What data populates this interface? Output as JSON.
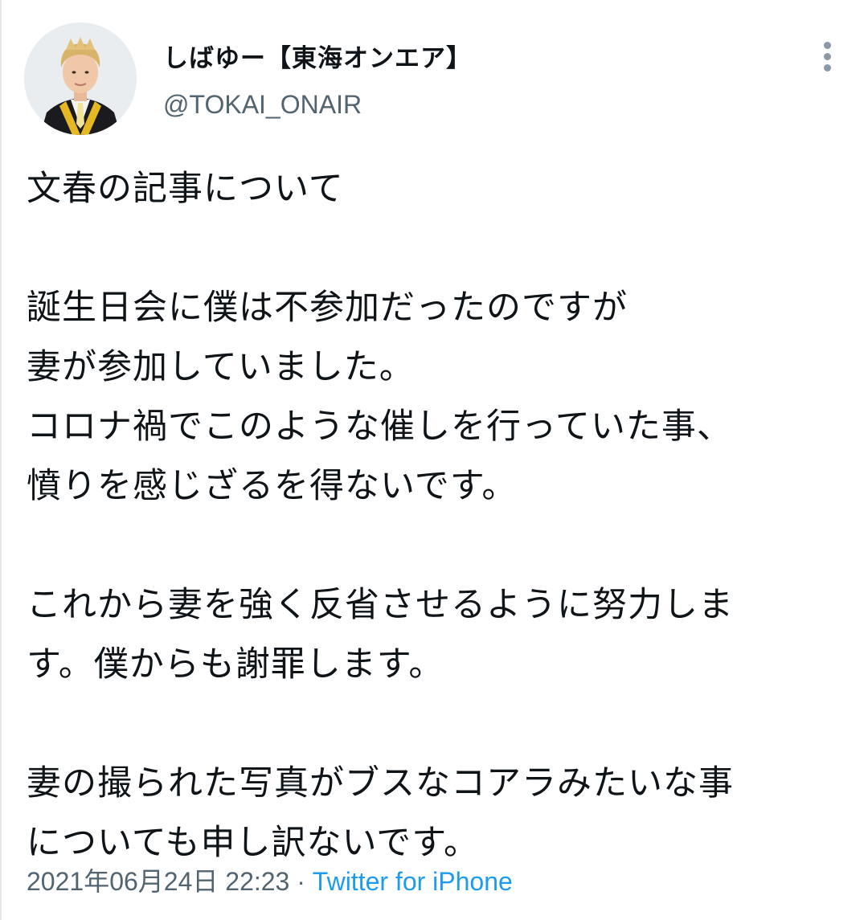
{
  "author": {
    "display_name": "しばゆー【東海オンエア】",
    "handle": "@TOKAI_ONAIR"
  },
  "tweet": {
    "lines": [
      "文春の記事について",
      "",
      "誕生日会に僕は不参加だったのですが",
      "妻が参加していました。",
      "コロナ禍でこのような催しを行っていた事、",
      "憤りを感じざるを得ないです。",
      "",
      "これから妻を強く反省させるように努力しま",
      "す。僕からも謝罪します。",
      "",
      "妻の撮られた写真がブスなコアラみたいな事",
      "についても申し訳ないです。"
    ]
  },
  "meta": {
    "timestamp": "2021年06月24日 22:23",
    "separator": " · ",
    "source": "Twitter for iPhone"
  },
  "icons": {
    "more": "more-vertical-icon"
  },
  "colors": {
    "text": "#0f1419",
    "secondary": "#536471",
    "link": "#1d9bf0"
  }
}
